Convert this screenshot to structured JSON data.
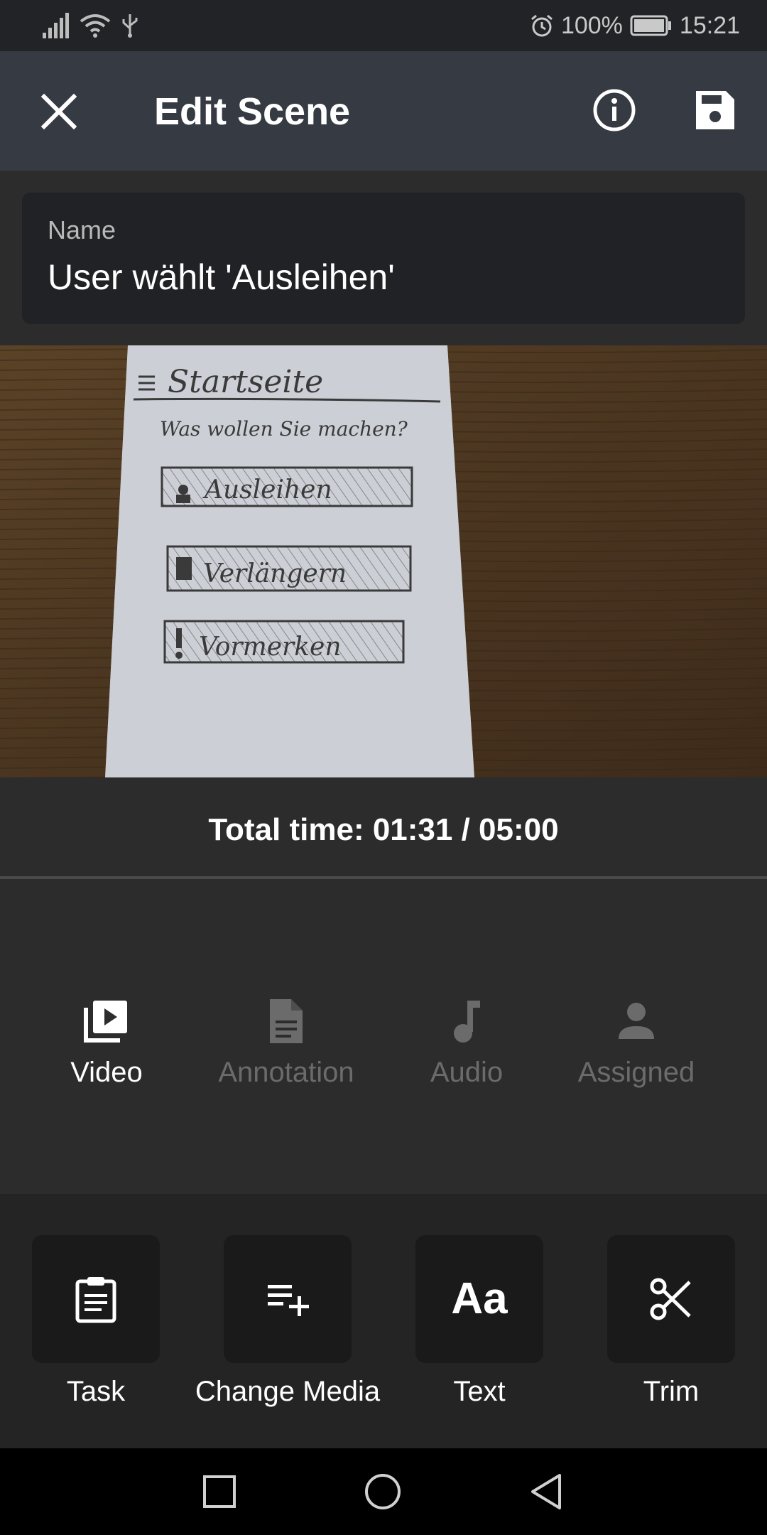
{
  "status_bar": {
    "battery": "100%",
    "time": "15:21",
    "icons": [
      "signal-icon",
      "wifi-icon",
      "usb-icon",
      "alarm-icon",
      "battery-icon"
    ]
  },
  "app_bar": {
    "title": "Edit Scene",
    "icons": [
      "close-icon",
      "info-icon",
      "save-icon"
    ]
  },
  "name_field": {
    "label": "Name",
    "value": "User wählt 'Ausleihen'"
  },
  "sketch": {
    "title": "Startseite",
    "question": "Was wollen Sie machen?",
    "buttons": [
      "Ausleihen",
      "Verlängern",
      "Vormerken"
    ]
  },
  "total_time": "Total time: 01:31 / 05:00",
  "tabs": [
    {
      "label": "Video",
      "icon": "video-library-icon",
      "active": true
    },
    {
      "label": "Annotation",
      "icon": "document-icon",
      "active": false
    },
    {
      "label": "Audio",
      "icon": "music-note-icon",
      "active": false
    },
    {
      "label": "Assigned",
      "icon": "person-icon",
      "active": false
    }
  ],
  "actions": [
    {
      "label": "Task",
      "icon": "clipboard-icon"
    },
    {
      "label": "Change Media",
      "icon": "playlist-add-icon"
    },
    {
      "label": "Text",
      "icon": "text-icon",
      "glyph": "Aa"
    },
    {
      "label": "Trim",
      "icon": "scissors-icon"
    }
  ],
  "colors": {
    "app_bar": "#363a42",
    "active_tab": "#ffffff",
    "inactive_tab": "#6b6b6b"
  }
}
